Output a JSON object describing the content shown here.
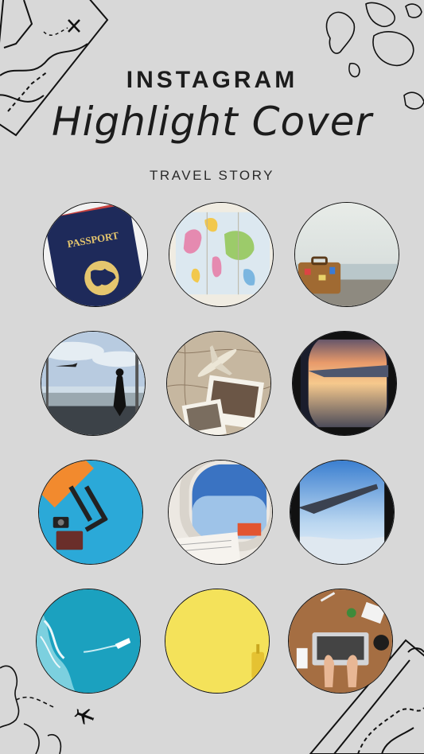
{
  "header": {
    "title_top": "INSTAGRAM",
    "title_main": "Highlight Cover",
    "subtitle": "TRAVEL STORY"
  },
  "highlights": [
    {
      "name": "passport",
      "icon": "passport-icon",
      "text": "PASSPORT"
    },
    {
      "name": "map",
      "icon": "map-icon"
    },
    {
      "name": "suitcase-beach",
      "icon": "suitcase-icon"
    },
    {
      "name": "airport",
      "icon": "airport-icon"
    },
    {
      "name": "plane-photos",
      "icon": "airplane-icon"
    },
    {
      "name": "sunset-wing",
      "icon": "wing-icon"
    },
    {
      "name": "blue-luggage",
      "icon": "luggage-icon"
    },
    {
      "name": "window-seat",
      "icon": "window-icon"
    },
    {
      "name": "wing-sky",
      "icon": "wing-icon"
    },
    {
      "name": "ocean-boat",
      "icon": "boat-icon"
    },
    {
      "name": "yellow-suitcase",
      "icon": "suitcase-icon"
    },
    {
      "name": "laptop-desk",
      "icon": "laptop-icon"
    }
  ],
  "colors": {
    "background": "#d8d8d8",
    "text": "#1c1c1c"
  }
}
